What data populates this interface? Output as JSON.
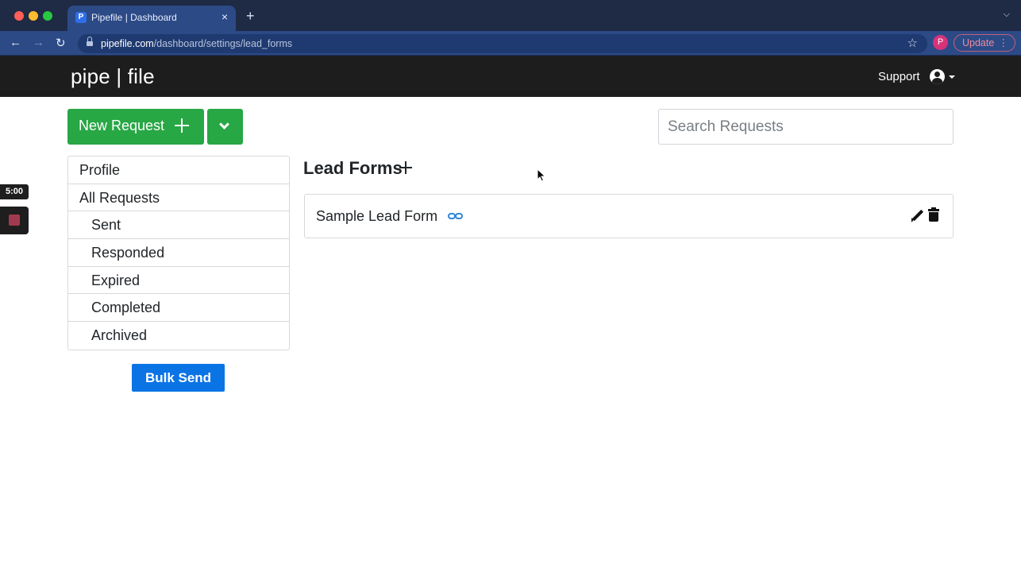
{
  "browser": {
    "tab_title": "Pipefile | Dashboard",
    "tab_favicon_letter": "P",
    "tab_close": "×",
    "new_tab": "+",
    "url_host": "pipefile.com",
    "url_path": "/dashboard/settings/lead_forms",
    "profile_initial": "P",
    "update_label": "Update",
    "update_menu": "⋮"
  },
  "site": {
    "brand": "pipe | file",
    "support_label": "Support"
  },
  "actions": {
    "new_request_label": "New Request",
    "search_placeholder": "Search Requests"
  },
  "sidebar": {
    "items": [
      {
        "label": "Profile"
      },
      {
        "label": "All Requests"
      },
      {
        "label": "Sent"
      },
      {
        "label": "Responded"
      },
      {
        "label": "Expired"
      },
      {
        "label": "Completed"
      },
      {
        "label": "Archived"
      }
    ],
    "bulk_send_label": "Bulk Send"
  },
  "main": {
    "section_title": "Lead Forms",
    "forms": [
      {
        "name": "Sample Lead Form"
      }
    ]
  },
  "recorder": {
    "timer": "5:00"
  },
  "colors": {
    "primary_green": "#28a745",
    "primary_blue": "#0b74e5",
    "nav_dark": "#1d1d1d",
    "link_blue": "#2f86d8"
  }
}
